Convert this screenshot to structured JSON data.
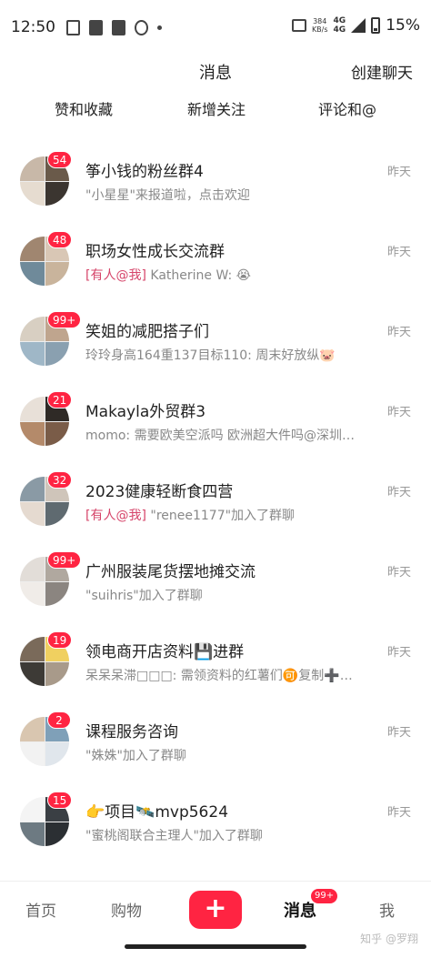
{
  "status_bar": {
    "time": "12:50",
    "net_speed": "384",
    "net_unit": "KB/s",
    "network_1": "4G",
    "network_2": "4G",
    "battery": "15%"
  },
  "header": {
    "title": "消息",
    "action": "创建聊天"
  },
  "quick_tabs": [
    "赞和收藏",
    "新增关注",
    "评论和@"
  ],
  "time_label": "昨天",
  "conversations": [
    {
      "badge": "54",
      "title": "筝小钱的粉丝群4",
      "mention": "",
      "preview": "\"小星星\"来报道啦，点击欢迎",
      "colors": [
        "#c8b8a8",
        "#6a5a4a",
        "#e6dcd0",
        "#3b3530"
      ]
    },
    {
      "badge": "48",
      "title": "职场女性成长交流群",
      "mention": "[有人@我]",
      "preview": " Katherine W: 😭",
      "colors": [
        "#a08670",
        "#d9c7b5",
        "#6f8a9a",
        "#c9b49c"
      ]
    },
    {
      "badge": "99+",
      "title": "笑姐的减肥搭子们",
      "mention": "",
      "preview": "玲玲身高164重137目标110: 周末好放纵🐷",
      "colors": [
        "#d8cfc2",
        "#bfa58e",
        "#9fb7c7",
        "#8aa0b0"
      ]
    },
    {
      "badge": "21",
      "title": "Makayla外贸群3",
      "mention": "",
      "preview": "momo: 需要欧美空派吗 欧洲超大件吗@深圳…",
      "colors": [
        "#e8e0d8",
        "#2f2a26",
        "#b48a6a",
        "#7a5c48"
      ]
    },
    {
      "badge": "32",
      "title": "2023健康轻断食四营",
      "mention": "[有人@我]",
      "preview": " \"renee1177\"加入了群聊",
      "colors": [
        "#8a9aa5",
        "#cfc5ba",
        "#e5dad0",
        "#5f6a70"
      ]
    },
    {
      "badge": "99+",
      "title": "广州服装尾货摆地摊交流",
      "mention": "",
      "preview": "\"suihris\"加入了群聊",
      "colors": [
        "#e2ddd8",
        "#b0a89f",
        "#f0ece8",
        "#8b8580"
      ]
    },
    {
      "badge": "19",
      "title": "领电商开店资料💾进群",
      "mention": "",
      "preview": "呆呆呆滞□□□: 需领资料的红薯们🉑复制➕…",
      "colors": [
        "#7a6a5a",
        "#f0d060",
        "#3d3a36",
        "#a89a8a"
      ]
    },
    {
      "badge": "2",
      "title": "课程服务咨询",
      "mention": "",
      "preview": "\"姝姝\"加入了群聊",
      "colors": [
        "#d9c6b0",
        "#7fa0b8",
        "#f2f2f2",
        "#e0e6ec"
      ]
    },
    {
      "badge": "15",
      "title": "👉项目🛰️mvp5624",
      "mention": "",
      "preview": "\"蜜桃阁联合主理人\"加入了群聊",
      "colors": [
        "#f4f4f4",
        "#3a3f44",
        "#6d7a82",
        "#2b2f33"
      ]
    }
  ],
  "bottom_nav": {
    "home": "首页",
    "shop": "购物",
    "plus": "+",
    "messages": "消息",
    "messages_badge": "99+",
    "me": "我",
    "watermark": "知乎 @罗翔"
  }
}
